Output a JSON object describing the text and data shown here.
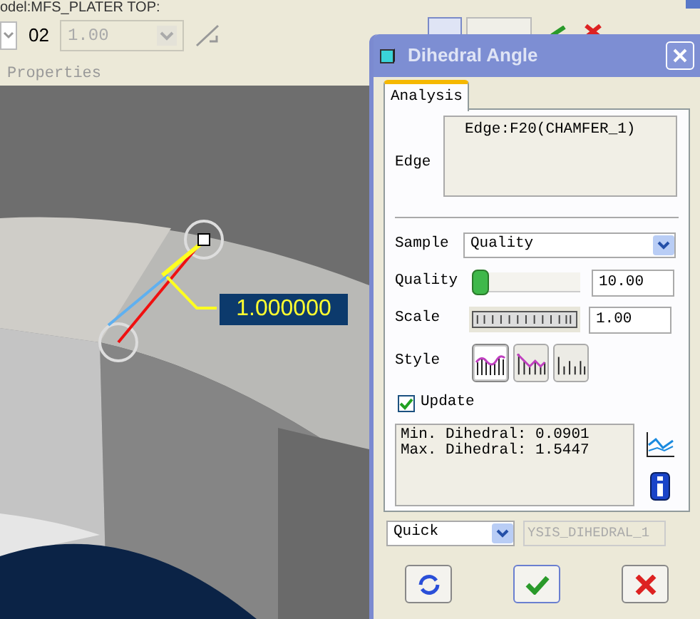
{
  "document_title": "odel:MFS_PLATER TOP:",
  "toolbar": {
    "dropdown_label": "02",
    "dropdown_value": "1.00"
  },
  "panel_heading": "Properties",
  "viewport": {
    "measurement": "1.000000"
  },
  "dialog": {
    "title": "Dihedral Angle",
    "tabs": [
      {
        "label": "Analysis",
        "selected": true
      }
    ],
    "edge": {
      "label": "Edge",
      "items": [
        "Edge:F20(CHAMFER_1)"
      ]
    },
    "sample": {
      "label": "Sample",
      "value": "Quality"
    },
    "quality": {
      "label": "Quality",
      "level": 0.0,
      "value": "10.00"
    },
    "scale": {
      "label": "Scale",
      "level": 1.0,
      "value": "1.00"
    },
    "style": {
      "label": "Style",
      "options": [
        {
          "kind": "curve",
          "selected": true
        },
        {
          "kind": "zigzag",
          "selected": false
        },
        {
          "kind": "bars",
          "selected": false
        }
      ]
    },
    "update": {
      "label": "Update",
      "checked": true
    },
    "results": [
      "Min. Dihedral: 0.0901",
      "Max. Dihedral: 1.5447"
    ],
    "mode": "Quick",
    "name_field": "YSIS_DIHEDRAL_1"
  }
}
